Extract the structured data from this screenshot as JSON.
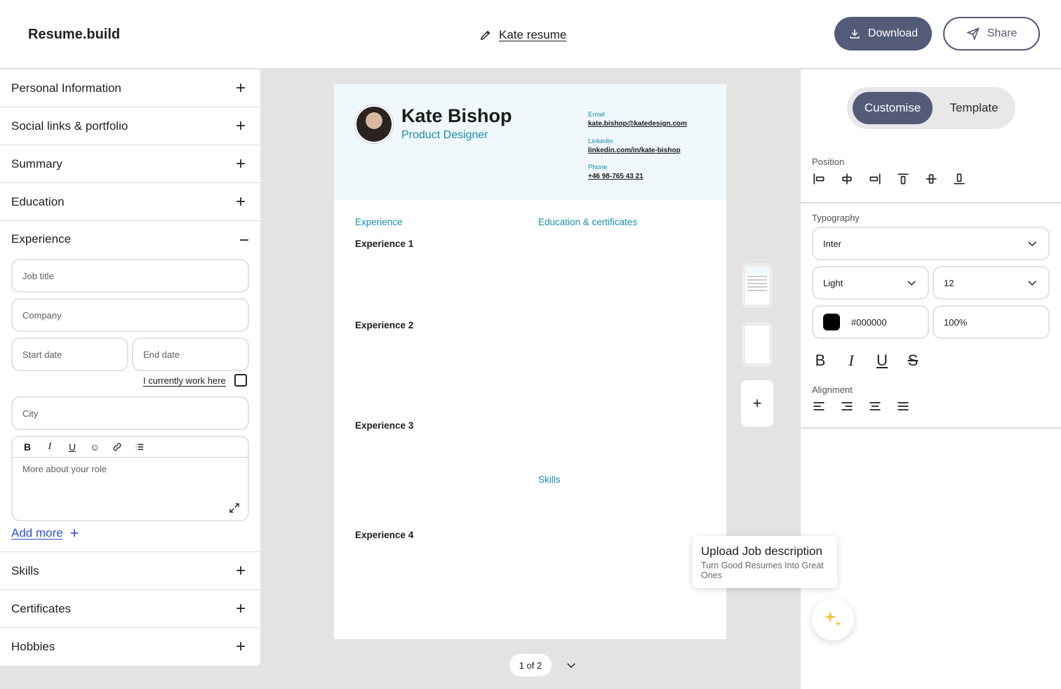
{
  "header": {
    "logo": "Resume.build",
    "doc_title": "Kate resume",
    "download_label": "Download",
    "share_label": "Share"
  },
  "left_panel": {
    "sections_top": [
      {
        "label": "Personal Information"
      },
      {
        "label": "Social links & portfolio"
      },
      {
        "label": "Summary"
      },
      {
        "label": "Education"
      }
    ],
    "experience": {
      "label": "Experience",
      "job_title_placeholder": "Job title",
      "company_placeholder": "Company",
      "start_date_placeholder": "Start date",
      "end_date_placeholder": "End date",
      "currently_work_label": "I currently work here",
      "city_placeholder": "City",
      "role_placeholder": "More about your role",
      "add_more_label": "Add more"
    },
    "sections_bottom": [
      {
        "label": "Skills"
      },
      {
        "label": "Certificates"
      },
      {
        "label": "Hobbies"
      }
    ]
  },
  "resume": {
    "name": "Kate Bishop",
    "role": "Product Designer",
    "contacts": [
      {
        "label": "Email",
        "value": "kate.bishop@katedesign.com"
      },
      {
        "label": "Linkedin",
        "value": "linkedin.com/in/kate-bishop"
      },
      {
        "label": "Phone",
        "value": "+46 98-765 43 21"
      }
    ],
    "experience_heading": "Experience",
    "education_heading": "Education & certificates",
    "skills_heading": "Skills",
    "experience_items": [
      "Experience 1",
      "Experience 2",
      "Experience 3",
      "Experience 4"
    ],
    "accent_color": "#1b8cb0"
  },
  "pager": {
    "label": "1 of 2"
  },
  "tooltip": {
    "title": "Upload Job description",
    "subtitle": "Turn Good Resumes Into Great Ones"
  },
  "right_panel": {
    "tab_active": "Customise",
    "tab_inactive": "Template",
    "position_label": "Position",
    "typography_label": "Typography",
    "font_family": "Inter",
    "font_weight": "Light",
    "font_size": "12",
    "color_hex": "#000000",
    "opacity": "100%",
    "alignment_label": "Alignment"
  },
  "colors": {
    "primary": "#545b78",
    "link": "#2e52d6",
    "sparkle": "#f2c94c"
  }
}
